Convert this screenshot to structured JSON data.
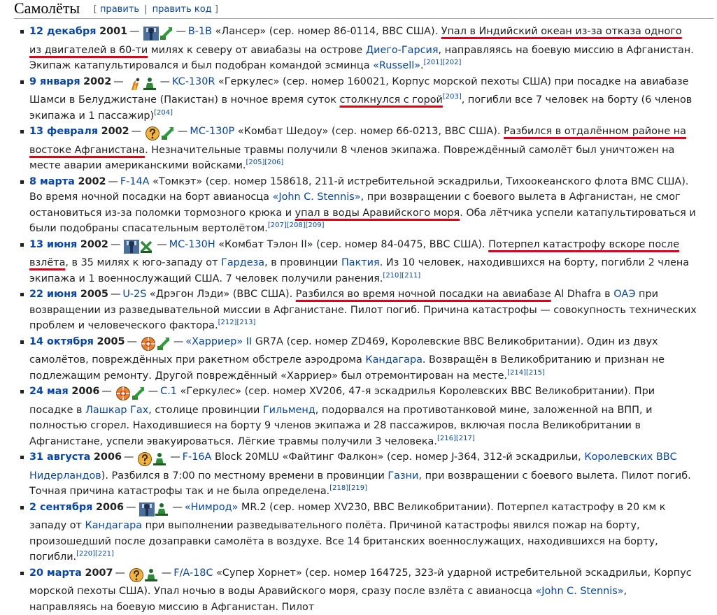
{
  "section": {
    "title": "Самолёты",
    "edit_open": "[",
    "edit_label": "править",
    "edit_sep": "|",
    "edit_code_label": "править код",
    "edit_close": "]"
  },
  "events": [
    {
      "date": "12 декабря",
      "year": "2001",
      "icons": [
        "mechanic-wrench-icon",
        "green-arrow-icon"
      ],
      "aircraft": "B-1B",
      "t1": " «Лансер» (сер. номер 86-0114, ВВС США). ",
      "u1": "Упал в Индийский океан из-за отказа одного из двигателей в 60-ти",
      "t2": " милях к северу от авиабазы на острове ",
      "l2": "Диего-Гарсия",
      "t3": ", направляясь на боевую миссию в Афганистан. Экипаж катапультировался и был подобран командой эсминца ",
      "l3": "«Russell»",
      "t4": ".",
      "refs": "[201][202]"
    },
    {
      "date": "9 января",
      "year": "2002",
      "icons": [
        "fire-figure-icon",
        "green-person-icon"
      ],
      "aircraft": "KC-130R",
      "t1": " «Геркулес» (сер. номер 160021, Корпус морской пехоты США) при посадке на авиабазе Шамси в Белуджистане (Пакистан) в ночное время суток ",
      "u1": "столкнулся с горой",
      "ref1": "[203]",
      "t2": ", погибли все 7 человек на борту (6 членов экипажа и 1 пассажир)",
      "refs": "[204]"
    },
    {
      "date": "13 февраля",
      "year": "2002",
      "icons": [
        "question-face-icon",
        "green-arrow-icon"
      ],
      "aircraft": "MC-130P",
      "t1": " «Комбат Шедоу» (сер. номер 66-0213, ВВС США). ",
      "u1": "Разбился в отдалённом районе на востоке Афганистана",
      "t2": ". Незначительные травмы получили 8 членов экипажа. Повреждённый самолёт был уничтожен на месте аварии американскими войсками.",
      "refs": "[205][206]"
    },
    {
      "date": "8 марта",
      "year": "2002",
      "icons": [],
      "aircraft": "F-14A",
      "t1": " «Томкэт» (сер. номер 158618, 211-й истребительной эскадрильи, Тихоокеанского флота ВМС США). Во время ночной посадки на борт авианосца ",
      "l1": "«John C. Stennis»",
      "t2": ", при возвращении с боевого вылета в Афганистан, не смог остановиться из-за поломки тормозного крюка и ",
      "u1": "упал в воды Аравийского моря",
      "t3": ". Оба лётчика успели катапультироваться и были подобраны спасательным вертолётом.",
      "refs": "[207][208][209]"
    },
    {
      "date": "13 июня",
      "year": "2002",
      "icons": [
        "mechanic-wrench-icon",
        "green-cross-icon"
      ],
      "aircraft": "MC-130H",
      "t1": " «Комбат Тэлон II» (сер. номер 84-0475, ВВС США). ",
      "u1": "Потерпел катастрофу вскоре после взлёта",
      "t2": ", в 35 милях к юго-западу от ",
      "l2": "Гардеза",
      "t3": ", в провинции ",
      "l3": "Пактия",
      "t4": ". Из 10 человек, находившихся на борту, погибли 2 члена экипажа и 1 военнослужащий США. 7 человек получили ранения.",
      "refs": "[210][211]"
    },
    {
      "date": "22 июня",
      "year": "2005",
      "icons": [],
      "aircraft": "U-2S",
      "t1": " «Дрэгон Лэди» (ВВС США). ",
      "u1": "Разбился во время ночной посадки на авиабазе",
      "t2": " Al Dhafra в ",
      "l2": "ОАЭ",
      "t3": " при возвращении из разведывательной миссии в Афганистане. Пилот погиб. Причина катастрофы — совокупность технических проблем и человеческого фактора.",
      "refs": "[212][213]"
    },
    {
      "date": "14 октября",
      "year": "2005",
      "icons": [
        "target-icon",
        "green-arrow-icon"
      ],
      "aircraft": "«Харриер» II",
      "t1": " GR7A (сер. номер ZD469, Королевские ВВС Великобритании). Один из двух самолётов, повреждённых при ракетном обстреле аэродрома ",
      "l1": "Кандагара",
      "t2": ". Возвращён в Великобританию и признан не подлежащим ремонту. Другой повреждённый «Харриер» был отремонтирован на месте.",
      "refs": "[214][215]"
    },
    {
      "date": "24 мая",
      "year": "2006",
      "icons": [
        "target-icon",
        "green-arrow-icon"
      ],
      "aircraft": "C.1",
      "t1": " «Геркулес» (сер. номер XV206, 47-я эскадрилья Королевских ВВС Великобритании). При посадке в ",
      "l1": "Лашкар Гах",
      "t2": ", столице провинции ",
      "l2": "Гильменд",
      "t3": ", подорвался на противотанковой мине, заложенной на ВПП, и полностью сгорел. Находившиеся на борту 9 членов экипажа и 28 пассажиров, включая посла Великобритании в Афганистане, успели эвакуироваться. Лёгкие травмы получили 3 человека.",
      "refs": "[216][217]"
    },
    {
      "date": "31 августа",
      "year": "2006",
      "icons": [
        "question-face-icon",
        "green-person-icon"
      ],
      "aircraft": "F-16A",
      "t1": " Block 20MLU «Файтинг Фалкон» (сер. номер J-364, 312-й эскадрильи, ",
      "l1": "Королевских ВВС Нидерландов",
      "t2": "). Разбился в 7:00 по местному времени в провинции ",
      "l2": "Газни",
      "t3": ", при возвращении с боевого вылета. Пилот погиб. Точная причина катастрофы так и не была определена.",
      "refs": "[218][219]"
    },
    {
      "date": "2 сентября",
      "year": "2006",
      "icons": [
        "mechanic-wrench-icon",
        "green-person-icon"
      ],
      "aircraft": "«Нимрод»",
      "t1": " MR.2 (сер. номер XV230, ВВС Великобритании). Потерпел катастрофу в 20 км к западу от ",
      "l1": "Кандагара",
      "t2": " при выполнении разведывательного полёта. Причиной катастрофы явился пожар на борту, произошедший после дозаправки самолёта в воздухе. Все 14 британских военнослужащих, находившихся на борту, погибли.",
      "refs": "[220][221]"
    },
    {
      "date": "20 марта",
      "year": "2007",
      "icons": [
        "question-face-icon",
        "green-person-icon"
      ],
      "aircraft": "F/A-18C",
      "t1": " «Супер Хорнет» (сер. номер 164725, 323-й ударной истребительной эскадрильи, Корпус морской пехоты США). Упал ночью в воды Аравийского моря, сразу после взлёта с авианосца ",
      "l1": "«John C. Stennis»",
      "t2": ", направляясь на боевую миссию в Афганистан. Пилот",
      "refs": ""
    }
  ],
  "separator": "—",
  "colors": {
    "link": "#0645ad",
    "underline": "#e3001b",
    "text": "#202122"
  }
}
